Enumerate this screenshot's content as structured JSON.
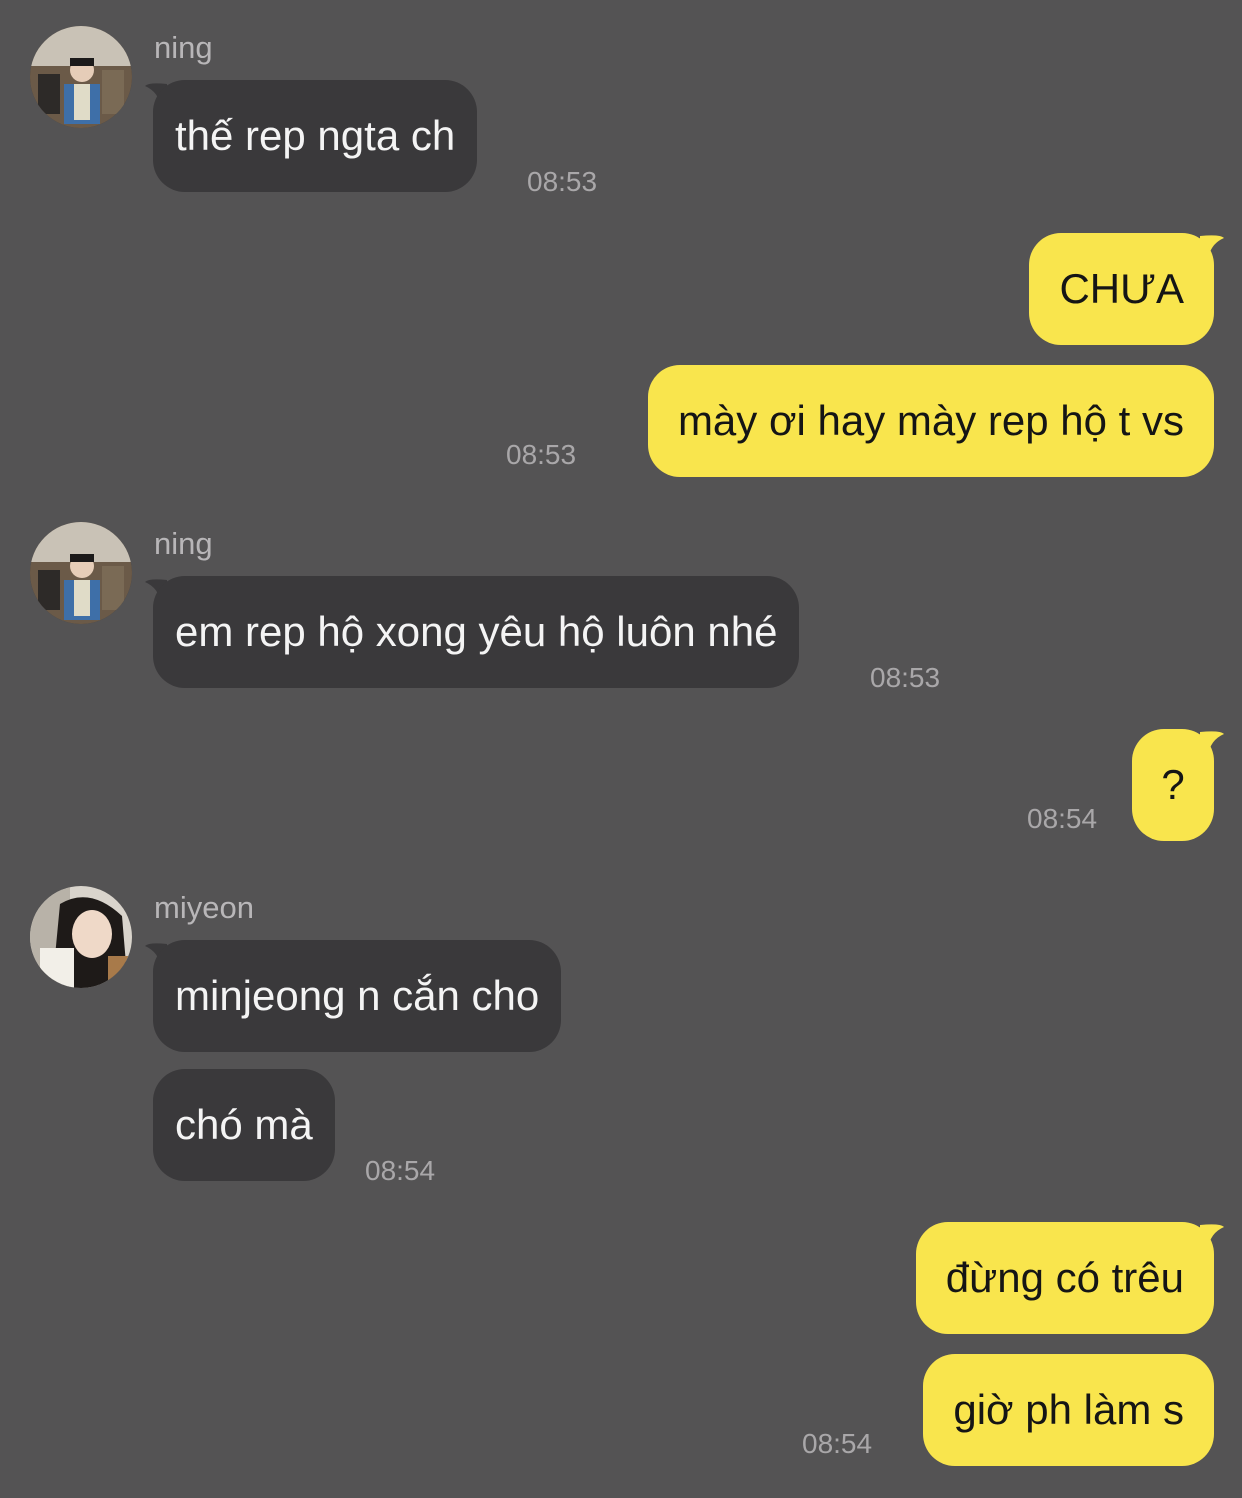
{
  "colors": {
    "background": "#545354",
    "incoming_bubble": "#3a393b",
    "outgoing_bubble": "#f9e54d",
    "timestamp": "#a9a7a9"
  },
  "messages": [
    {
      "sender": "ning",
      "text": "thế rep ngta ch",
      "time": "08:53"
    },
    {
      "sender": "me",
      "text": "CHƯA"
    },
    {
      "sender": "me",
      "text": "mày ơi hay mày rep hộ t vs",
      "time": "08:53"
    },
    {
      "sender": "ning",
      "text": "em rep hộ xong yêu hộ luôn nhé",
      "time": "08:53"
    },
    {
      "sender": "me",
      "text": "?",
      "time": "08:54"
    },
    {
      "sender": "miyeon",
      "text": "minjeong n cắn cho"
    },
    {
      "sender": "miyeon",
      "text": "chó mà",
      "time": "08:54"
    },
    {
      "sender": "me",
      "text": "đừng có trêu"
    },
    {
      "sender": "me",
      "text": "giờ ph làm s",
      "time": "08:54"
    }
  ]
}
